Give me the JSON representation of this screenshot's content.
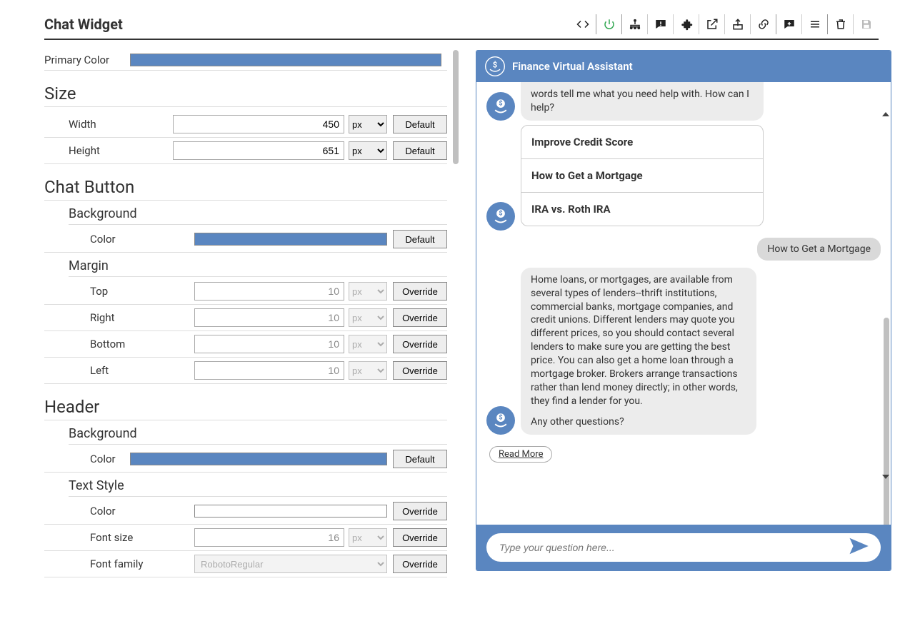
{
  "title": "Chat Widget",
  "toolbar": {
    "code": "code-icon",
    "power": "power-icon",
    "tree": "sitemap-icon",
    "comment": "comment-icon",
    "puzzle": "puzzle-icon",
    "open": "open-in-new-icon",
    "share": "share-icon",
    "link": "link-icon",
    "addcomment": "add-comment-icon",
    "menu": "menu-icon",
    "trash": "trash-icon",
    "save": "save-icon"
  },
  "colors": {
    "primary": "#5a86c0",
    "white": "#ffffff"
  },
  "buttons": {
    "default": "Default",
    "override": "Override"
  },
  "units": {
    "px": "px"
  },
  "left": {
    "primaryColor": {
      "label": "Primary Color"
    },
    "size": {
      "heading": "Size",
      "width": {
        "label": "Width",
        "value": "450"
      },
      "height": {
        "label": "Height",
        "value": "651"
      }
    },
    "chatButton": {
      "heading": "Chat Button",
      "background": {
        "heading": "Background",
        "color": {
          "label": "Color"
        }
      },
      "margin": {
        "heading": "Margin",
        "top": {
          "label": "Top",
          "value": "10"
        },
        "right": {
          "label": "Right",
          "value": "10"
        },
        "bottom": {
          "label": "Bottom",
          "value": "10"
        },
        "left": {
          "label": "Left",
          "value": "10"
        }
      }
    },
    "header": {
      "heading": "Header",
      "background": {
        "heading": "Background",
        "color": {
          "label": "Color"
        }
      },
      "textStyle": {
        "heading": "Text Style",
        "color": {
          "label": "Color"
        },
        "fontSize": {
          "label": "Font size",
          "value": "16"
        },
        "fontFamily": {
          "label": "Font family",
          "value": "RobotoRegular"
        }
      }
    }
  },
  "chat": {
    "headerTitle": "Finance Virtual Assistant",
    "greetingTail": "words tell me what you need help with. How can I help?",
    "options": [
      "Improve Credit Score",
      "How to Get a Mortgage",
      "IRA vs. Roth IRA"
    ],
    "userMsg": "How to Get a Mortgage",
    "answer": "Home loans, or mortgages, are available from several types of lenders--thrift institutions, commercial banks, mortgage  companies, and credit unions. Different lenders may quote you different prices,  so you should contact several lenders to make sure you are getting the best price. You can also get a home loan through a mortgage broker. Brokers arrange transactions rather than lend  money directly; in other words, they find a lender for you.",
    "followup": "Any other questions?",
    "readMore": "Read More",
    "placeholder": "Type your question here..."
  }
}
